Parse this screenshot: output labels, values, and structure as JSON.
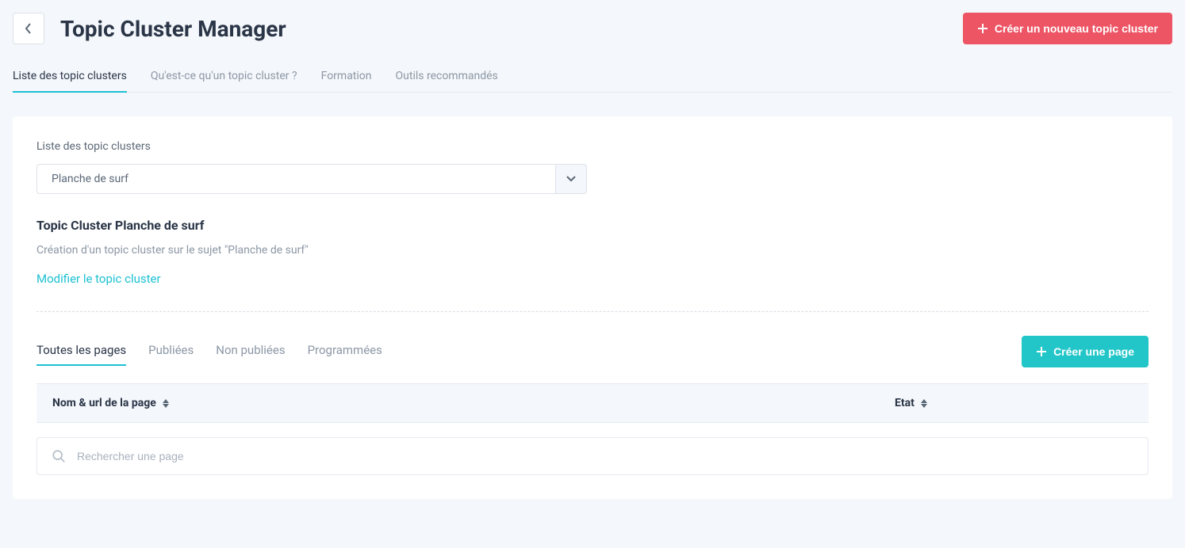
{
  "header": {
    "title": "Topic Cluster Manager",
    "create_button": "Créer un nouveau topic cluster"
  },
  "tabs": {
    "list": "Liste des topic clusters",
    "what": "Qu'est-ce qu'un topic cluster ?",
    "training": "Formation",
    "tools": "Outils recommandés"
  },
  "cluster": {
    "list_label": "Liste des topic clusters",
    "selected": "Planche de surf",
    "title": "Topic Cluster Planche de surf",
    "description": "Création d'un topic cluster sur le sujet \"Planche de surf\"",
    "edit_link": "Modifier le topic cluster"
  },
  "pages": {
    "tabs": {
      "all": "Toutes les pages",
      "published": "Publiées",
      "unpublished": "Non publiées",
      "scheduled": "Programmées"
    },
    "create_button": "Créer une page",
    "columns": {
      "name": "Nom & url de la page",
      "state": "Etat"
    },
    "search_placeholder": "Rechercher une page"
  }
}
